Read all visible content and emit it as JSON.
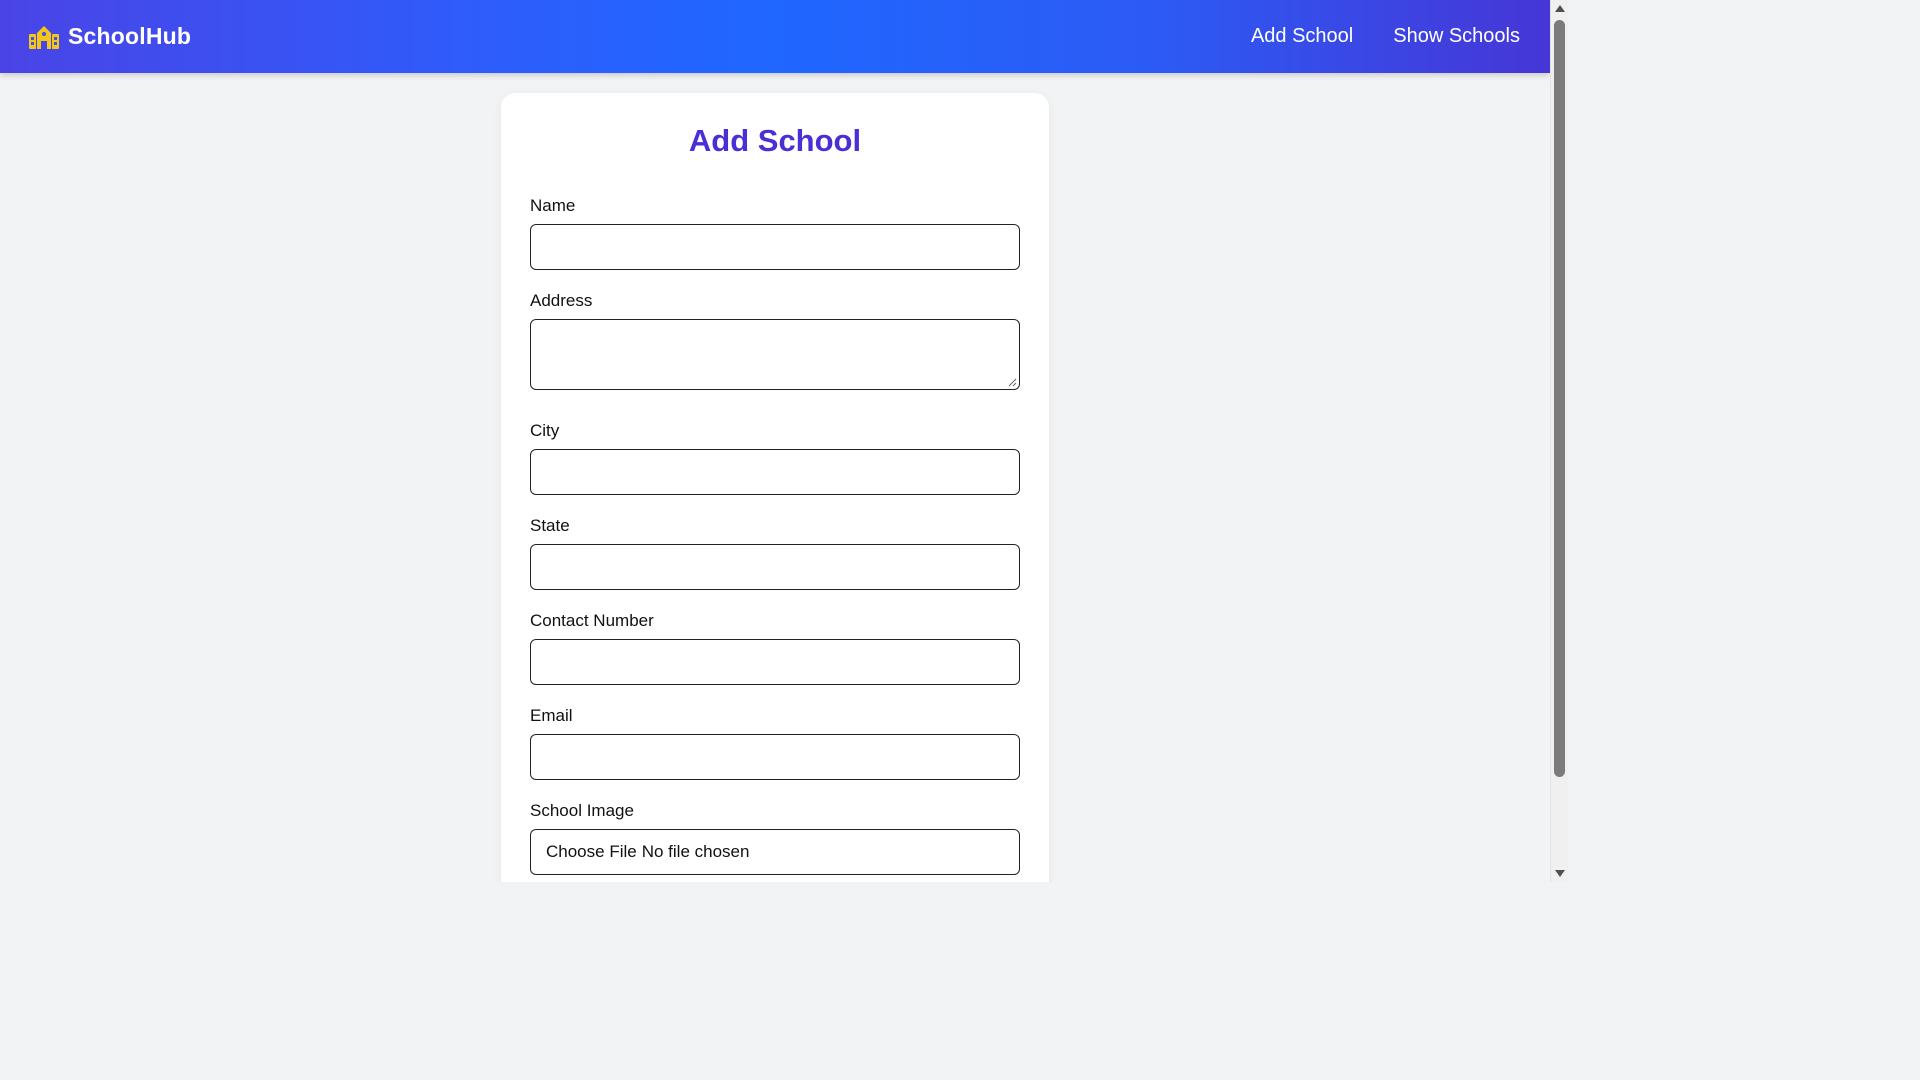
{
  "navbar": {
    "brand_name": "SchoolHub",
    "brand_icon": "school-building-icon",
    "brand_icon_color": "#f5c518",
    "links": [
      "Add School",
      "Show Schools"
    ],
    "gradient_colors": [
      "#4a44e6",
      "#1f67ff",
      "#4636d6"
    ]
  },
  "form": {
    "title": "Add School",
    "title_color": "#4a2fd6",
    "fields": {
      "name": {
        "label": "Name",
        "value": ""
      },
      "address": {
        "label": "Address",
        "value": ""
      },
      "city": {
        "label": "City",
        "value": ""
      },
      "state": {
        "label": "State",
        "value": ""
      },
      "contact": {
        "label": "Contact Number",
        "value": ""
      },
      "email": {
        "label": "Email",
        "value": ""
      },
      "image": {
        "label": "School Image",
        "button_label": "Choose File",
        "status": "No file chosen"
      }
    }
  }
}
